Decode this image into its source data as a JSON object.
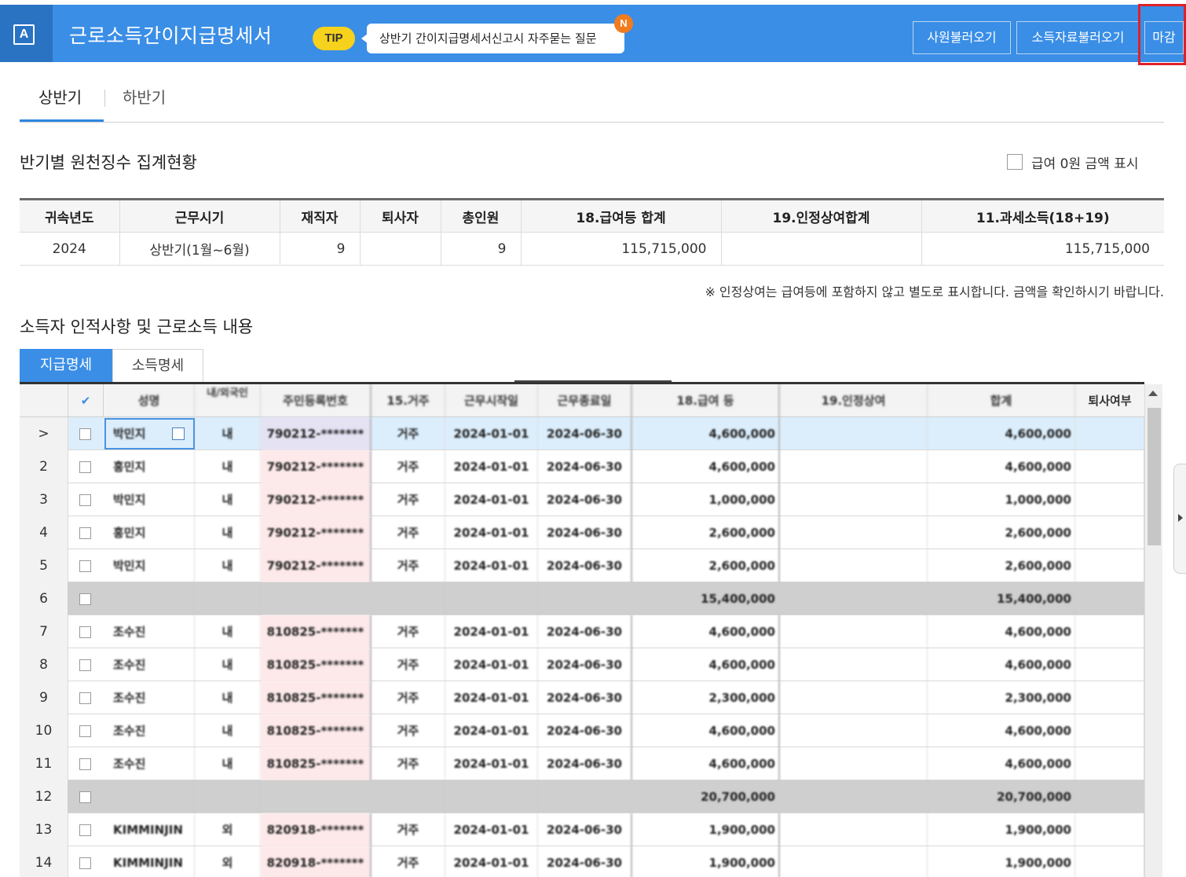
{
  "header": {
    "logo_letter": "A",
    "title": "근로소득간이지급명세서",
    "tip_badge": "TIP",
    "tip_text": "상반기 간이지급명세서신고시 자주묻는 질문",
    "new_badge": "N",
    "buttons": [
      "사원불러오기",
      "소득자료불러오기",
      "마감"
    ]
  },
  "period_tabs": {
    "first": "상반기",
    "second": "하반기",
    "active": "상반기"
  },
  "summary": {
    "title": "반기별 원천징수 집계현황",
    "zero_checkbox_label": "급여 0원 금액 표시",
    "zero_checkbox_checked": false,
    "headers": [
      "귀속년도",
      "근무시기",
      "재직자",
      "퇴사자",
      "총인원",
      "18.급여등 합계",
      "19.인정상여합계",
      "11.과세소득(18+19)"
    ],
    "row": [
      "2024",
      "상반기(1월~6월)",
      "9",
      "",
      "9",
      "115,715,000",
      "",
      "115,715,000"
    ],
    "note": "※ 인정상여는 급여등에 포함하지 않고 별도로 표시합니다. 금액을 확인하시기 바랍니다."
  },
  "detail": {
    "title": "소득자 인적사항 및 근로소득 내용",
    "tabs": [
      "지급명세",
      "소득명세"
    ],
    "active_tab": "지급명세",
    "columns": [
      "",
      "✔",
      "성명",
      "내/외국인",
      "주민등록번호",
      "15.거주",
      "근무시작일",
      "근무종료일",
      "18.급여 등",
      "19.인정상여",
      "합계",
      "퇴사여부"
    ],
    "rows": [
      {
        "no": ">",
        "name": "박민지",
        "nat": "내",
        "ssn": "790212-*******",
        "res": "거주",
        "start": "2024-01-01",
        "end": "2024-06-30",
        "pay": "4,600,000",
        "bonus": "",
        "total": "4,600,000",
        "retired": "",
        "type": "selected"
      },
      {
        "no": "2",
        "name": "홍민지",
        "nat": "내",
        "ssn": "790212-*******",
        "res": "거주",
        "start": "2024-01-01",
        "end": "2024-06-30",
        "pay": "4,600,000",
        "bonus": "",
        "total": "4,600,000",
        "retired": "",
        "type": "normal"
      },
      {
        "no": "3",
        "name": "박민지",
        "nat": "내",
        "ssn": "790212-*******",
        "res": "거주",
        "start": "2024-01-01",
        "end": "2024-06-30",
        "pay": "1,000,000",
        "bonus": "",
        "total": "1,000,000",
        "retired": "",
        "type": "normal"
      },
      {
        "no": "4",
        "name": "홍민지",
        "nat": "내",
        "ssn": "790212-*******",
        "res": "거주",
        "start": "2024-01-01",
        "end": "2024-06-30",
        "pay": "2,600,000",
        "bonus": "",
        "total": "2,600,000",
        "retired": "",
        "type": "normal"
      },
      {
        "no": "5",
        "name": "박민지",
        "nat": "내",
        "ssn": "790212-*******",
        "res": "거주",
        "start": "2024-01-01",
        "end": "2024-06-30",
        "pay": "2,600,000",
        "bonus": "",
        "total": "2,600,000",
        "retired": "",
        "type": "normal"
      },
      {
        "no": "6",
        "name": "",
        "nat": "",
        "ssn": "",
        "res": "",
        "start": "",
        "end": "",
        "pay": "15,400,000",
        "bonus": "",
        "total": "15,400,000",
        "retired": "",
        "type": "subtotal"
      },
      {
        "no": "7",
        "name": "조수진",
        "nat": "내",
        "ssn": "810825-*******",
        "res": "거주",
        "start": "2024-01-01",
        "end": "2024-06-30",
        "pay": "4,600,000",
        "bonus": "",
        "total": "4,600,000",
        "retired": "",
        "type": "normal"
      },
      {
        "no": "8",
        "name": "조수진",
        "nat": "내",
        "ssn": "810825-*******",
        "res": "거주",
        "start": "2024-01-01",
        "end": "2024-06-30",
        "pay": "4,600,000",
        "bonus": "",
        "total": "4,600,000",
        "retired": "",
        "type": "normal"
      },
      {
        "no": "9",
        "name": "조수진",
        "nat": "내",
        "ssn": "810825-*******",
        "res": "거주",
        "start": "2024-01-01",
        "end": "2024-06-30",
        "pay": "2,300,000",
        "bonus": "",
        "total": "2,300,000",
        "retired": "",
        "type": "normal"
      },
      {
        "no": "10",
        "name": "조수진",
        "nat": "내",
        "ssn": "810825-*******",
        "res": "거주",
        "start": "2024-01-01",
        "end": "2024-06-30",
        "pay": "4,600,000",
        "bonus": "",
        "total": "4,600,000",
        "retired": "",
        "type": "normal"
      },
      {
        "no": "11",
        "name": "조수진",
        "nat": "내",
        "ssn": "810825-*******",
        "res": "거주",
        "start": "2024-01-01",
        "end": "2024-06-30",
        "pay": "4,600,000",
        "bonus": "",
        "total": "4,600,000",
        "retired": "",
        "type": "normal"
      },
      {
        "no": "12",
        "name": "",
        "nat": "",
        "ssn": "",
        "res": "",
        "start": "",
        "end": "",
        "pay": "20,700,000",
        "bonus": "",
        "total": "20,700,000",
        "retired": "",
        "type": "subtotal"
      },
      {
        "no": "13",
        "name": "KIMMINJIN",
        "nat": "외",
        "ssn": "820918-*******",
        "res": "거주",
        "start": "2024-01-01",
        "end": "2024-06-30",
        "pay": "1,900,000",
        "bonus": "",
        "total": "1,900,000",
        "retired": "",
        "type": "normal"
      },
      {
        "no": "14",
        "name": "KIMMINJIN",
        "nat": "외",
        "ssn": "820918-*******",
        "res": "거주",
        "start": "2024-01-01",
        "end": "2024-06-30",
        "pay": "1,900,000",
        "bonus": "",
        "total": "1,900,000",
        "retired": "",
        "type": "normal"
      }
    ]
  }
}
